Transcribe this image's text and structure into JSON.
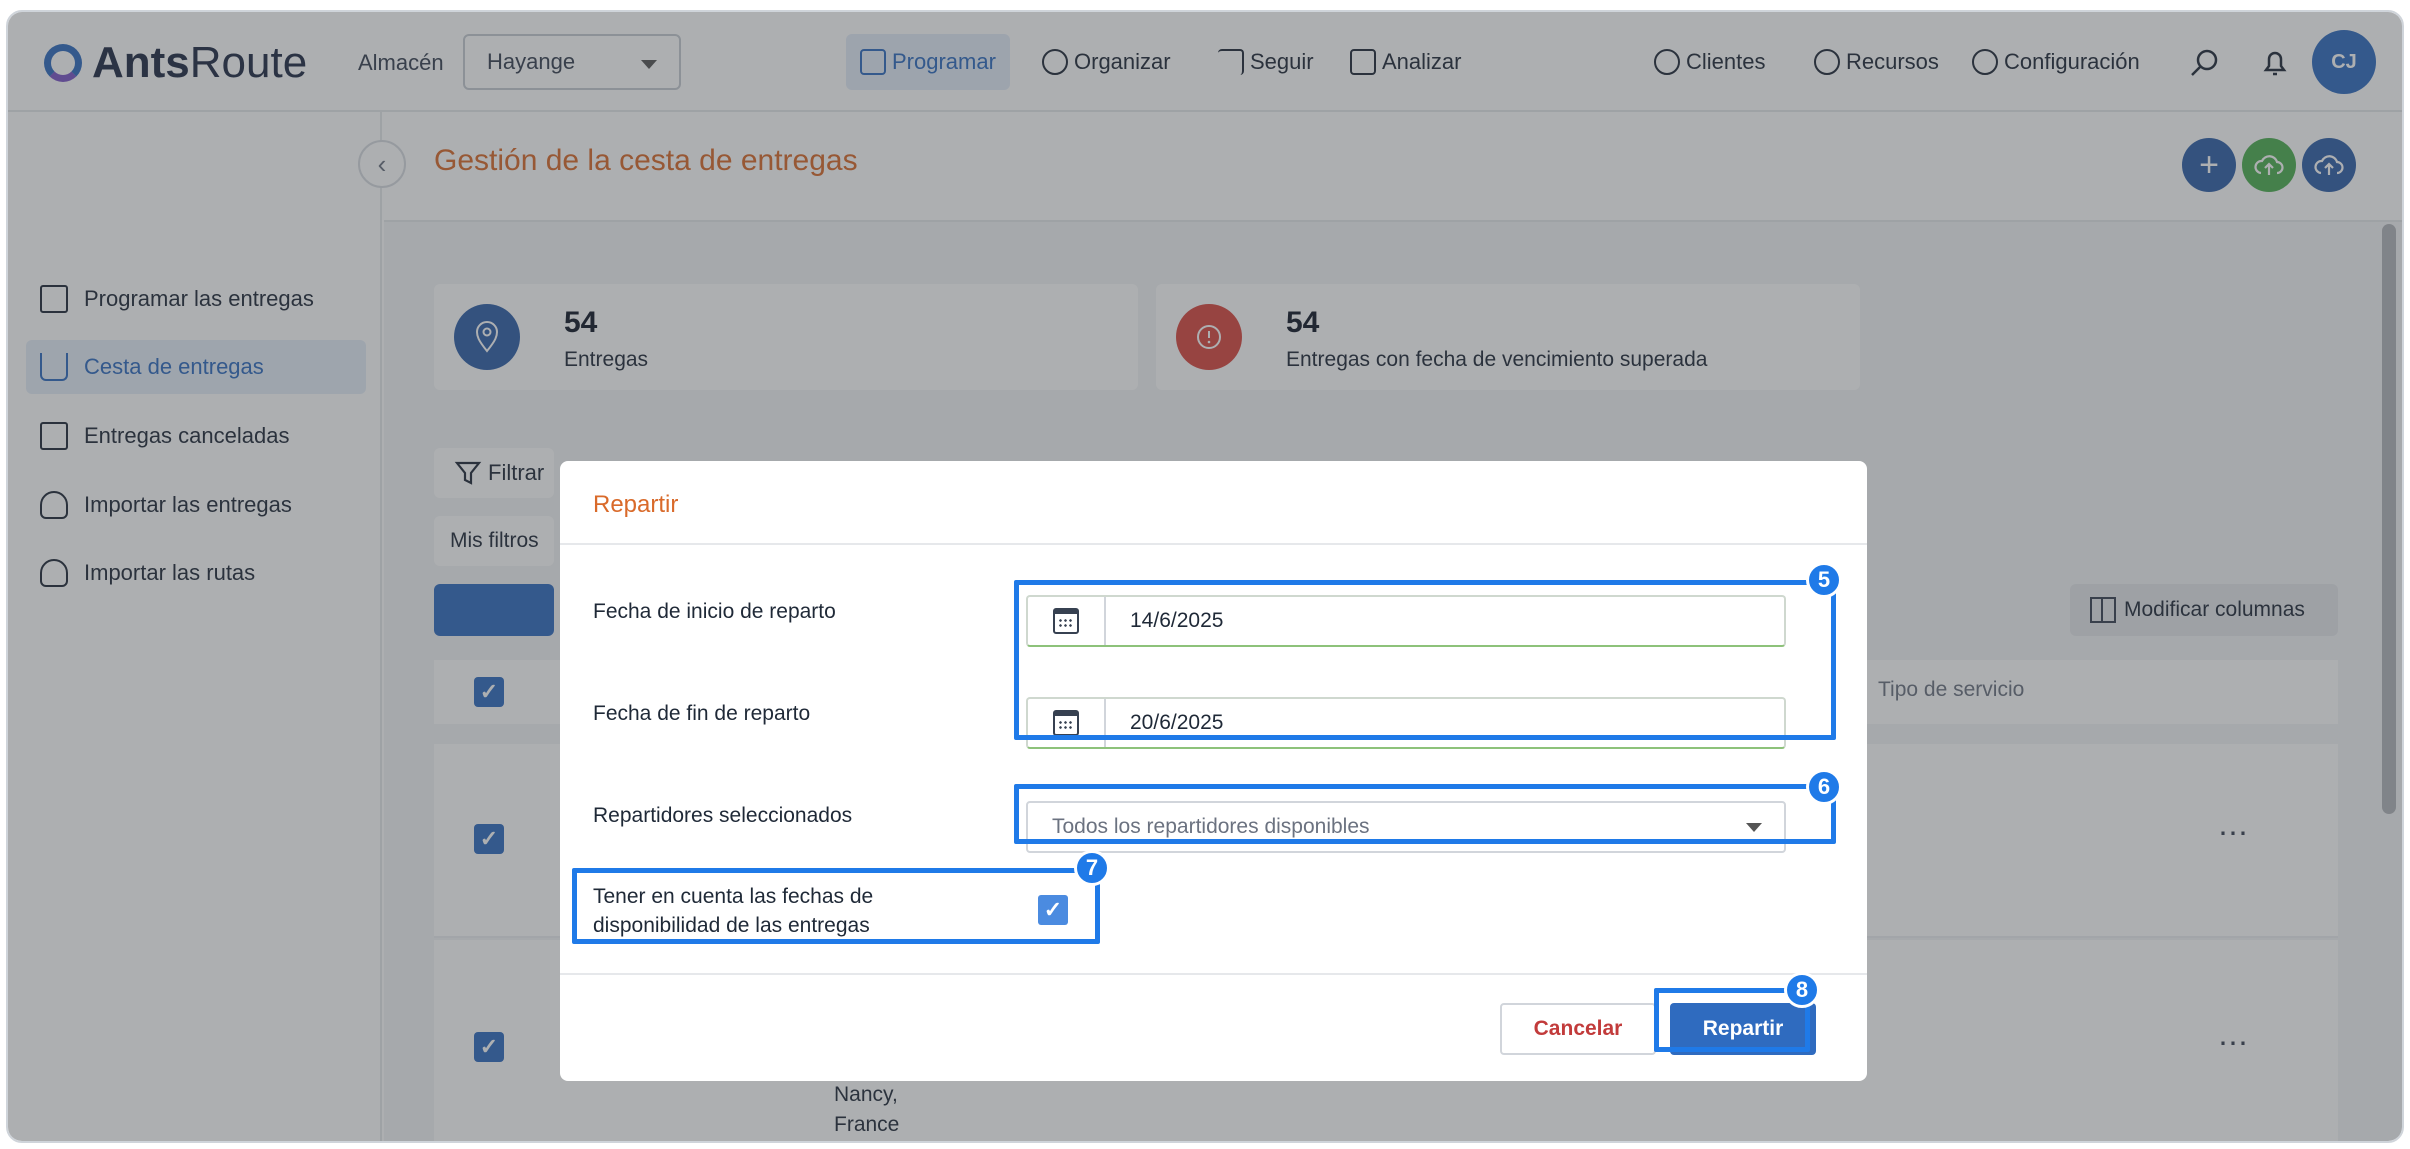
{
  "app": {
    "logo_bold": "Ants",
    "logo_light": "Route"
  },
  "topbar": {
    "almacen_label": "Almacén",
    "almacen_value": "Hayange",
    "nav": [
      {
        "label": "Programar",
        "icon": "calendar-grid-icon"
      },
      {
        "label": "Organizar",
        "icon": "speedometer-icon"
      },
      {
        "label": "Seguir",
        "icon": "signpost-icon"
      },
      {
        "label": "Analizar",
        "icon": "line-chart-icon"
      }
    ],
    "right_nav": [
      {
        "label": "Clientes",
        "icon": "users-group-icon"
      },
      {
        "label": "Recursos",
        "icon": "user-gear-icon"
      },
      {
        "label": "Configuración",
        "icon": "gear-icon"
      }
    ],
    "avatar_initials": "CJ"
  },
  "sidebar": {
    "items": [
      {
        "label": "Programar las entregas",
        "icon": "calendar-plus-icon"
      },
      {
        "label": "Cesta de entregas",
        "icon": "cart-icon"
      },
      {
        "label": "Entregas canceladas",
        "icon": "calendar-x-icon"
      },
      {
        "label": "Importar las entregas",
        "icon": "cloud-upload-icon"
      },
      {
        "label": "Importar las rutas",
        "icon": "cloud-upload-icon"
      }
    ]
  },
  "main": {
    "title": "Gestión de la cesta de entregas",
    "stats": [
      {
        "value": "54",
        "label": "Entregas",
        "color": "#2f5fa8"
      },
      {
        "value": "54",
        "label": "Entregas con fecha de vencimiento superada",
        "color": "#d9473f"
      }
    ],
    "filter_label": "Filtrar",
    "my_filters_label": "Mis filtros",
    "modify_columns_label": "Modificar columnas",
    "col_tipo_servicio": "Tipo de servicio",
    "row_address_line1": "Nancy,",
    "row_address_line2": "France"
  },
  "modal": {
    "title": "Repartir",
    "start_label": "Fecha de inicio de reparto",
    "start_value": "14/6/2025",
    "end_label": "Fecha de fin de reparto",
    "end_value": "20/6/2025",
    "drivers_label": "Repartidores seleccionados",
    "drivers_placeholder": "Todos los repartidores disponibles",
    "availability_label_1": "Tener en cuenta las fechas de",
    "availability_label_2": "disponibilidad de las entregas",
    "cancel_label": "Cancelar",
    "submit_label": "Repartir"
  },
  "annotations": [
    "5",
    "6",
    "7",
    "8"
  ],
  "colors": {
    "accent": "#2f6bbf",
    "title_orange": "#d96a2a",
    "highlight": "#1f7ae8",
    "cancel_red": "#c23b3b"
  }
}
